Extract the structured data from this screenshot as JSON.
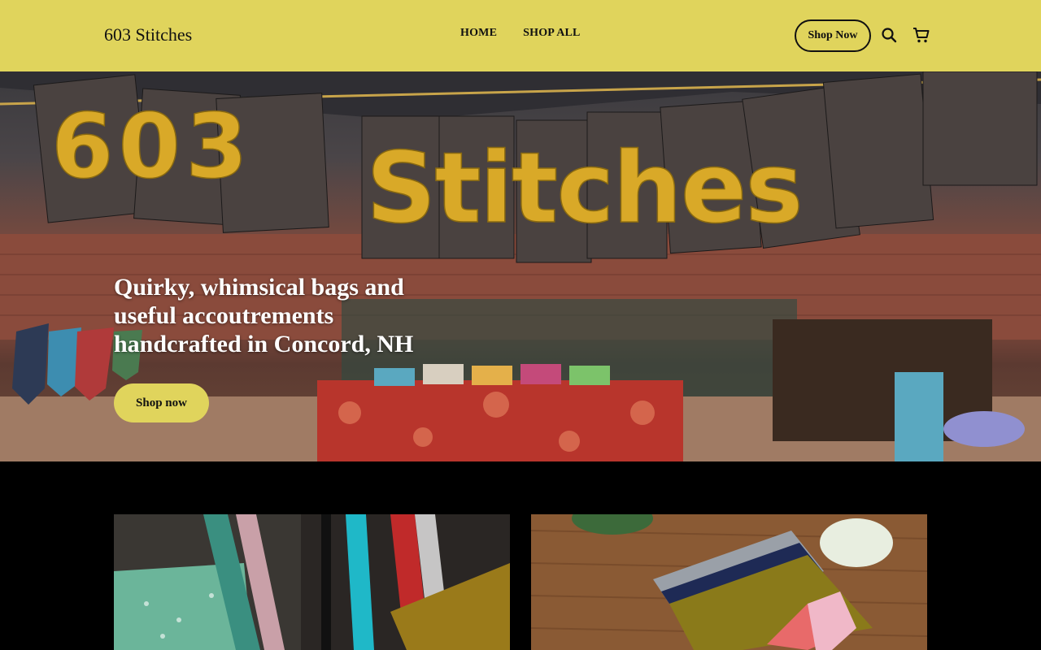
{
  "header": {
    "logo": "603 Stitches",
    "nav": [
      {
        "label": "HOME"
      },
      {
        "label": "SHOP ALL"
      }
    ],
    "shop_button": "Shop Now",
    "icons": {
      "search": "search-icon",
      "cart": "cart-icon"
    }
  },
  "hero": {
    "banner_text": "603 Stitches",
    "headline": "Quirky, whimsical bags and useful accoutrements handcrafted in Concord, NH",
    "cta": "Shop now"
  },
  "tiles": [
    {
      "name": "tote-bags-photo"
    },
    {
      "name": "fabric-pouches-photo"
    }
  ],
  "colors": {
    "header_bg": "#e0d45c",
    "accent": "#e0d45c",
    "text": "#111111",
    "page_bg": "#000000"
  }
}
